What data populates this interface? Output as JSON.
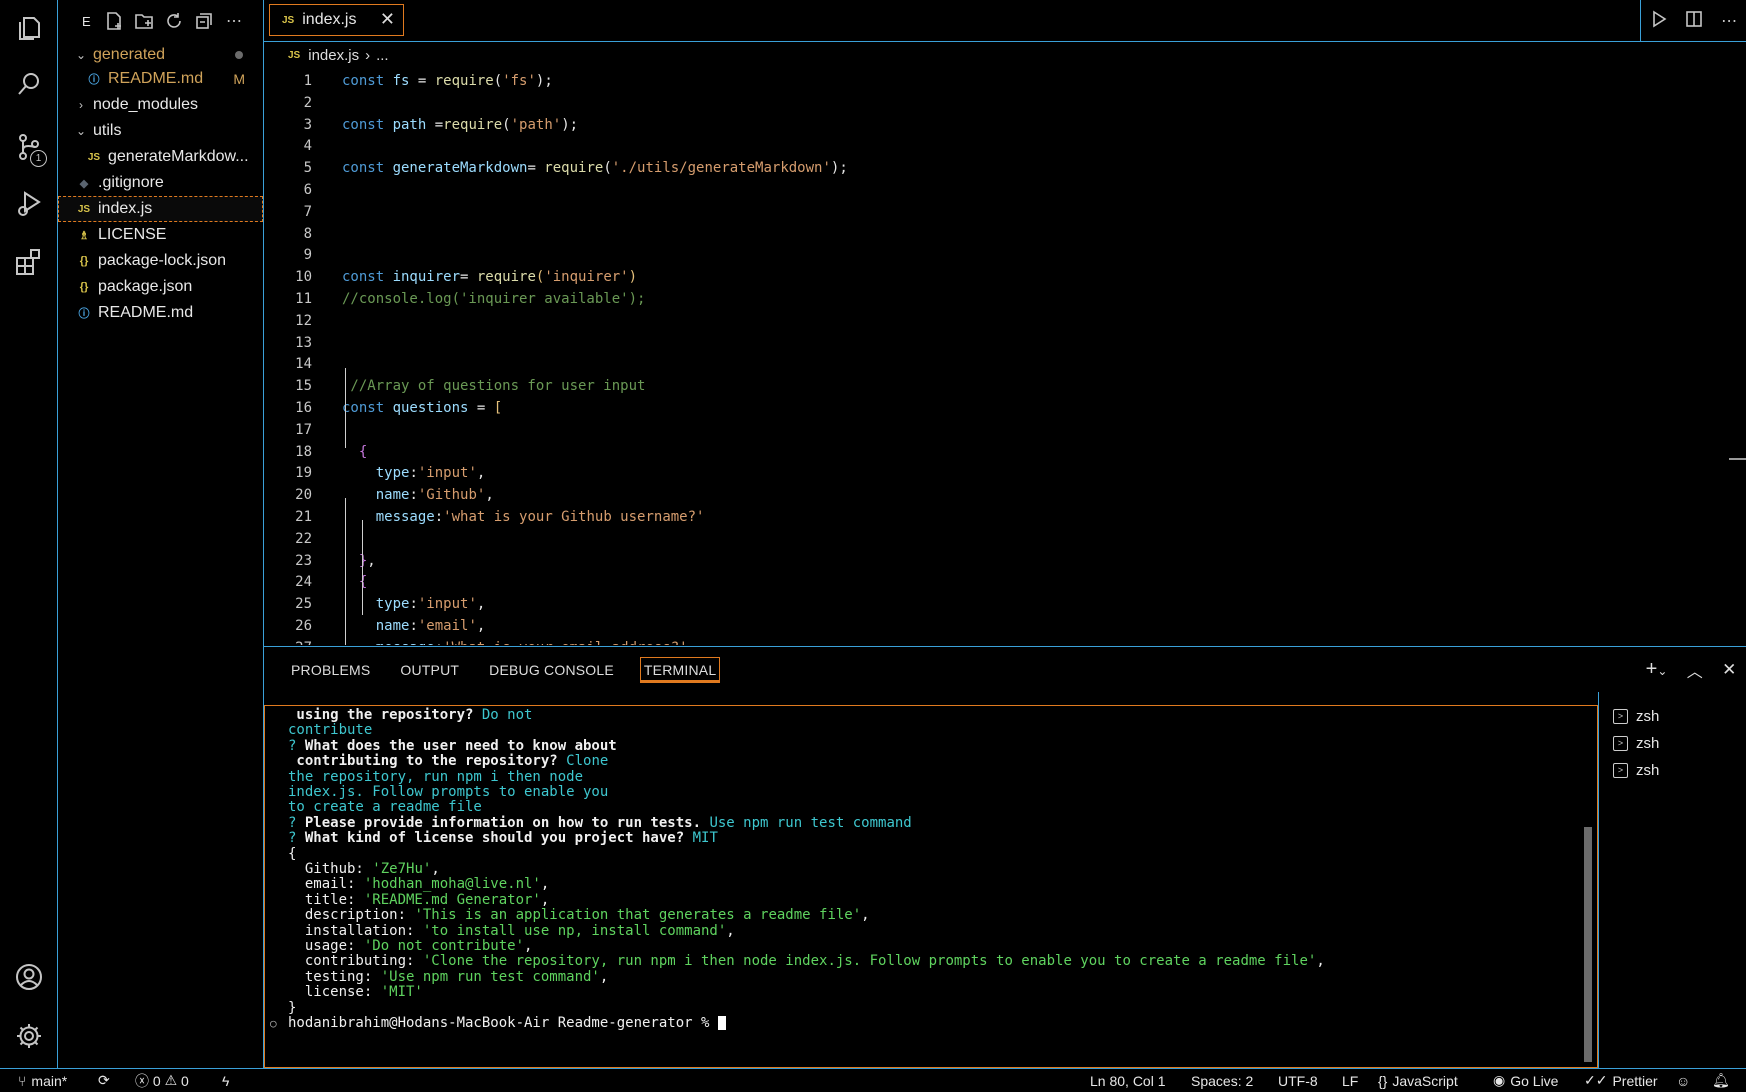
{
  "sidebar": {
    "title": "E",
    "items": [
      {
        "label": "generated",
        "kind": "folder-open",
        "decoration": "dot"
      },
      {
        "label": "README.md",
        "kind": "info",
        "decoration": "M"
      },
      {
        "label": "node_modules",
        "kind": "folder-closed"
      },
      {
        "label": "utils",
        "kind": "folder-open"
      },
      {
        "label": "generateMarkdow...",
        "kind": "js"
      },
      {
        "label": ".gitignore",
        "kind": "git"
      },
      {
        "label": "index.js",
        "kind": "js",
        "selected": true
      },
      {
        "label": "LICENSE",
        "kind": "license"
      },
      {
        "label": "package-lock.json",
        "kind": "json"
      },
      {
        "label": "package.json",
        "kind": "json"
      },
      {
        "label": "README.md",
        "kind": "info"
      }
    ]
  },
  "source_control_badge": "1",
  "tab": {
    "label": "index.js",
    "icon": "JS",
    "close": "✕"
  },
  "breadcrumb": {
    "file": "index.js",
    "sep": "›",
    "rest": "..."
  },
  "code": [
    {
      "n": "1",
      "t": [
        [
          "k",
          "const "
        ],
        [
          "v",
          "fs"
        ],
        [
          "p",
          " = "
        ],
        [
          "f",
          "require"
        ],
        [
          "p",
          "("
        ],
        [
          "s",
          "'fs'"
        ],
        [
          "p",
          ");"
        ]
      ]
    },
    {
      "n": "2",
      "t": []
    },
    {
      "n": "3",
      "t": [
        [
          "k",
          "const "
        ],
        [
          "v",
          "path"
        ],
        [
          "p",
          " ="
        ],
        [
          "f",
          "require"
        ],
        [
          "p",
          "("
        ],
        [
          "s",
          "'path'"
        ],
        [
          "p",
          ");"
        ]
      ]
    },
    {
      "n": "4",
      "t": []
    },
    {
      "n": "5",
      "t": [
        [
          "k",
          "const "
        ],
        [
          "v",
          "generateMarkdown"
        ],
        [
          "p",
          "= "
        ],
        [
          "f",
          "require"
        ],
        [
          "p",
          "("
        ],
        [
          "s",
          "'./utils/generateMarkdown'"
        ],
        [
          "p",
          ");"
        ]
      ]
    },
    {
      "n": "6",
      "t": []
    },
    {
      "n": "7",
      "t": []
    },
    {
      "n": "8",
      "t": []
    },
    {
      "n": "9",
      "t": []
    },
    {
      "n": "10",
      "t": [
        [
          "k",
          "const "
        ],
        [
          "v",
          "inquirer"
        ],
        [
          "p",
          "= "
        ],
        [
          "f",
          "require"
        ],
        [
          "br",
          "("
        ],
        [
          "s",
          "'inquirer'"
        ],
        [
          "br",
          ")"
        ]
      ]
    },
    {
      "n": "11",
      "t": [
        [
          "c",
          "//console.log('inquirer available');"
        ]
      ]
    },
    {
      "n": "12",
      "t": []
    },
    {
      "n": "13",
      "t": []
    },
    {
      "n": "14",
      "t": []
    },
    {
      "n": "15",
      "t": [
        [
          "c",
          " //Array of questions for user input"
        ]
      ]
    },
    {
      "n": "16",
      "t": [
        [
          "k",
          "const "
        ],
        [
          "v",
          "questions"
        ],
        [
          "p",
          " = "
        ],
        [
          "br",
          "["
        ]
      ]
    },
    {
      "n": "17",
      "t": []
    },
    {
      "n": "18",
      "t": [
        [
          "p",
          "  "
        ],
        [
          "br2",
          "{"
        ]
      ]
    },
    {
      "n": "19",
      "t": [
        [
          "p",
          "    "
        ],
        [
          "v",
          "type"
        ],
        [
          "p",
          ":"
        ],
        [
          "s",
          "'input'"
        ],
        [
          "p",
          ","
        ]
      ]
    },
    {
      "n": "20",
      "t": [
        [
          "p",
          "    "
        ],
        [
          "v",
          "name"
        ],
        [
          "p",
          ":"
        ],
        [
          "s",
          "'Github'"
        ],
        [
          "p",
          ","
        ]
      ]
    },
    {
      "n": "21",
      "t": [
        [
          "p",
          "    "
        ],
        [
          "v",
          "message"
        ],
        [
          "p",
          ":"
        ],
        [
          "s",
          "'what is your Github username?'"
        ]
      ]
    },
    {
      "n": "22",
      "t": []
    },
    {
      "n": "23",
      "t": [
        [
          "p",
          "  "
        ],
        [
          "br2",
          "}"
        ],
        [
          "p",
          ","
        ]
      ]
    },
    {
      "n": "24",
      "t": [
        [
          "p",
          "  "
        ],
        [
          "br2",
          "{"
        ]
      ]
    },
    {
      "n": "25",
      "t": [
        [
          "p",
          "    "
        ],
        [
          "v",
          "type"
        ],
        [
          "p",
          ":"
        ],
        [
          "s",
          "'input'"
        ],
        [
          "p",
          ","
        ]
      ]
    },
    {
      "n": "26",
      "t": [
        [
          "p",
          "    "
        ],
        [
          "v",
          "name"
        ],
        [
          "p",
          ":"
        ],
        [
          "s",
          "'email'"
        ],
        [
          "p",
          ","
        ]
      ]
    },
    {
      "n": "27",
      "t": [
        [
          "p",
          "    "
        ],
        [
          "v",
          "message"
        ],
        [
          "p",
          ":"
        ],
        [
          "s",
          "'What is your email address?'"
        ]
      ]
    }
  ],
  "panel": {
    "tabs": [
      "PROBLEMS",
      "OUTPUT",
      "DEBUG CONSOLE",
      "TERMINAL"
    ],
    "active_tab": "TERMINAL",
    "terminals": [
      "zsh",
      "zsh",
      "zsh"
    ]
  },
  "terminal": [
    [
      [
        "b",
        " using the repository? "
      ],
      [
        "c",
        "Do not"
      ]
    ],
    [
      [
        "c",
        "contribute"
      ]
    ],
    [
      [
        "c",
        "? "
      ],
      [
        "b",
        "What does the user need to know about"
      ]
    ],
    [
      [
        "b",
        " contributing to the repository? "
      ],
      [
        "c",
        "Clone"
      ]
    ],
    [
      [
        "c",
        "the repository, run npm i then node"
      ]
    ],
    [
      [
        "c",
        "index.js. Follow prompts to enable you"
      ]
    ],
    [
      [
        "c",
        "to create a readme file"
      ]
    ],
    [
      [
        "c",
        "? "
      ],
      [
        "b",
        "Please provide information on how to run tests. "
      ],
      [
        "c",
        "Use npm run test command"
      ]
    ],
    [
      [
        "c",
        "? "
      ],
      [
        "b",
        "What kind of license should you project have? "
      ],
      [
        "c",
        "MIT"
      ]
    ],
    [
      [
        "w",
        "{"
      ]
    ],
    [
      [
        "w",
        "  Github: "
      ],
      [
        "g",
        "'Ze7Hu'"
      ],
      [
        "w",
        ","
      ]
    ],
    [
      [
        "w",
        "  email: "
      ],
      [
        "g",
        "'hodhan_moha@live.nl'"
      ],
      [
        "w",
        ","
      ]
    ],
    [
      [
        "w",
        "  title: "
      ],
      [
        "g",
        "'README.md Generator'"
      ],
      [
        "w",
        ","
      ]
    ],
    [
      [
        "w",
        "  description: "
      ],
      [
        "g",
        "'This is an application that generates a readme file'"
      ],
      [
        "w",
        ","
      ]
    ],
    [
      [
        "w",
        "  installation: "
      ],
      [
        "g",
        "'to install use np, install command'"
      ],
      [
        "w",
        ","
      ]
    ],
    [
      [
        "w",
        "  usage: "
      ],
      [
        "g",
        "'Do not contribute'"
      ],
      [
        "w",
        ","
      ]
    ],
    [
      [
        "w",
        "  contributing: "
      ],
      [
        "g",
        "'Clone the repository, run npm i then node index.js. Follow prompts to enable you to create a readme file'"
      ],
      [
        "w",
        ","
      ]
    ],
    [
      [
        "w",
        "  testing: "
      ],
      [
        "g",
        "'Use npm run test command'"
      ],
      [
        "w",
        ","
      ]
    ],
    [
      [
        "w",
        "  license: "
      ],
      [
        "g",
        "'MIT'"
      ]
    ],
    [
      [
        "w",
        "}"
      ]
    ],
    [
      [
        "w",
        "hodanibrahim@Hodans-MacBook-Air Readme-generator % "
      ]
    ]
  ],
  "status": {
    "branch": "main*",
    "errors": "0",
    "warnings": "0",
    "position": "Ln 80, Col 1",
    "spaces": "Spaces: 2",
    "encoding": "UTF-8",
    "eol": "LF",
    "language": "JavaScript",
    "golive": "Go Live",
    "prettier": "Prettier"
  }
}
